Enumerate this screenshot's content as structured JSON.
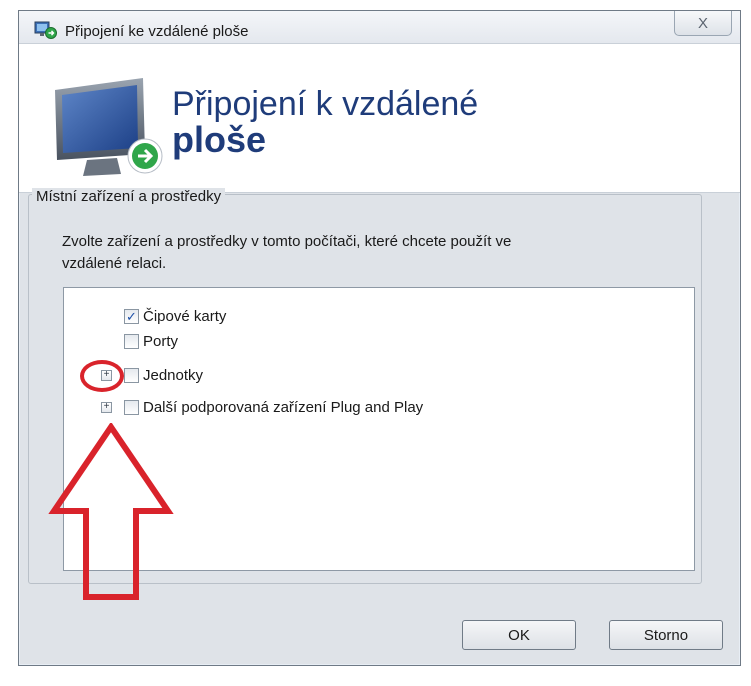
{
  "window": {
    "title": "Připojení ke vzdálené ploše",
    "close_glyph": "X"
  },
  "header": {
    "title_line1": "Připojení k vzdálené",
    "title_line2": "ploše"
  },
  "group": {
    "label": "Místní zařízení a prostředky",
    "description_line1": "Zvolte zařízení a prostředky v tomto počítači, které chcete použít ve",
    "description_line2": "vzdálené relaci."
  },
  "tree": {
    "items": [
      {
        "label": "Čipové karty",
        "checked": true,
        "expandable": false
      },
      {
        "label": "Porty",
        "checked": false,
        "expandable": false
      },
      {
        "label": "Jednotky",
        "checked": false,
        "expandable": true
      },
      {
        "label": "Další podporovaná zařízení Plug and Play",
        "checked": false,
        "expandable": true
      }
    ],
    "expander_glyph": "+"
  },
  "buttons": {
    "ok_label": "OK",
    "cancel_label": "Storno"
  },
  "icons": {
    "title_icon": "remote-desktop-icon",
    "header_icon": "remote-desktop-monitor-icon",
    "annotation": "red-arrow-icon"
  },
  "colors": {
    "annotation_red": "#d9232b",
    "header_title": "#1f3c7a"
  }
}
